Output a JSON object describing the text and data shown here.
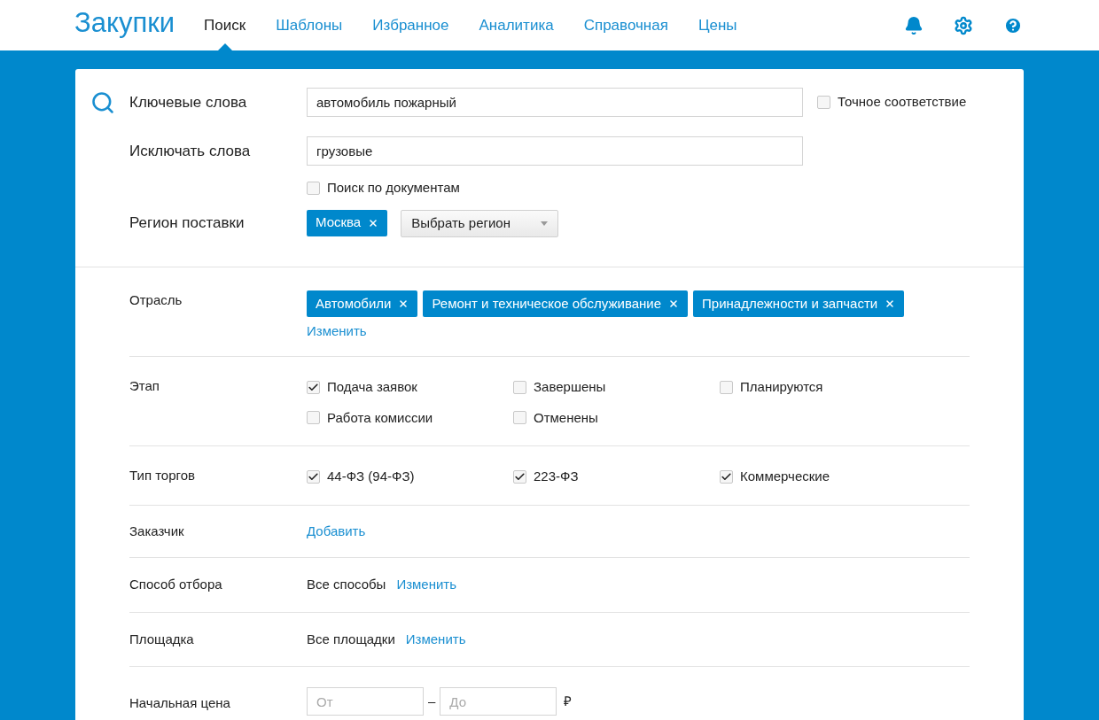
{
  "header": {
    "logo": "Закупки",
    "nav": [
      {
        "label": "Поиск",
        "selected": true
      },
      {
        "label": "Шаблоны",
        "selected": false
      },
      {
        "label": "Избранное",
        "selected": false
      },
      {
        "label": "Аналитика",
        "selected": false
      },
      {
        "label": "Справочная",
        "selected": false
      },
      {
        "label": "Цены",
        "selected": false
      }
    ]
  },
  "search": {
    "keywords": {
      "label": "Ключевые слова",
      "value": "автомобиль пожарный"
    },
    "exact_match": {
      "label": "Точное соответствие",
      "checked": false
    },
    "exclude": {
      "label": "Исключать слова",
      "value": "грузовые"
    },
    "search_documents": {
      "label": "Поиск по документам",
      "checked": false
    },
    "region": {
      "label": "Регион поставки",
      "tags": [
        "Москва"
      ],
      "select": "Выбрать регион"
    }
  },
  "filters": [
    {
      "kind": "tags",
      "label": "Отрасль",
      "tags": [
        "Автомобили",
        "Ремонт и техническое обслуживание",
        "Принадлежности и запчасти"
      ],
      "link": "Изменить"
    },
    {
      "kind": "checkboxes",
      "label": "Этап",
      "options": [
        {
          "label": "Подача заявок",
          "checked": true
        },
        {
          "label": "Завершены",
          "checked": false
        },
        {
          "label": "Планируются",
          "checked": false
        },
        {
          "label": "Работа комиссии",
          "checked": false
        },
        {
          "label": "Отменены",
          "checked": false
        }
      ]
    },
    {
      "kind": "checkboxes",
      "label": "Тип торгов",
      "options": [
        {
          "label": "44-ФЗ (94-ФЗ)",
          "checked": true
        },
        {
          "label": "223-ФЗ",
          "checked": true
        },
        {
          "label": "Коммерческие",
          "checked": true
        }
      ]
    },
    {
      "kind": "link",
      "label": "Заказчик",
      "link": "Добавить"
    },
    {
      "kind": "value_link",
      "label": "Способ отбора",
      "value": "Все способы",
      "link": "Изменить"
    },
    {
      "kind": "value_link",
      "label": "Площадка",
      "value": "Все площадки",
      "link": "Изменить"
    },
    {
      "kind": "range",
      "label": "Начальная цена",
      "from": {
        "placeholder": "От"
      },
      "separator": "–",
      "to": {
        "placeholder": "До"
      },
      "currency": "₽"
    }
  ]
}
